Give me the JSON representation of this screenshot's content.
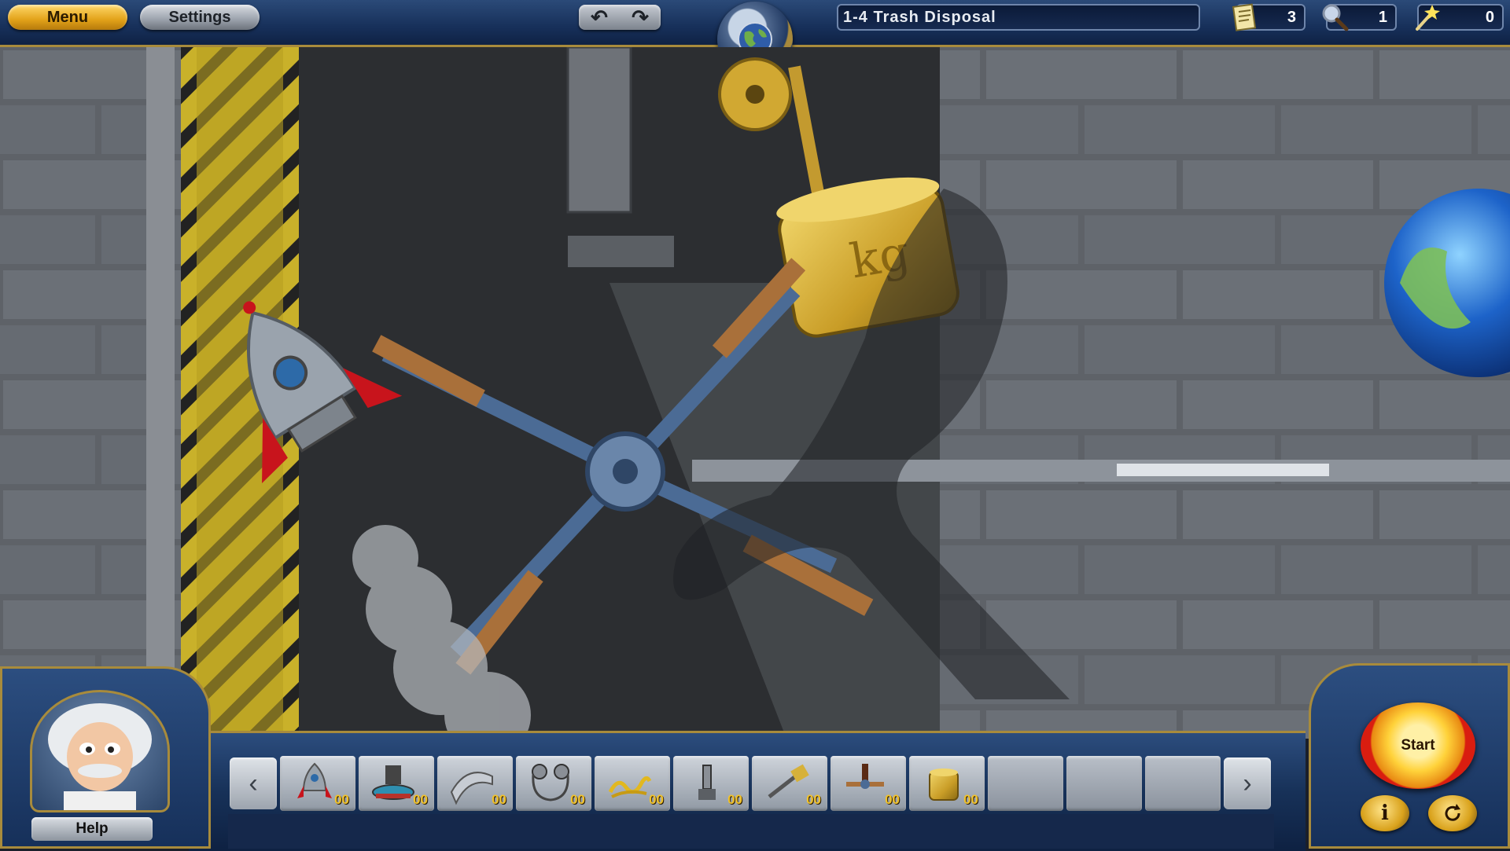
{
  "header": {
    "menu_label": "Menu",
    "settings_label": "Settings",
    "undo_icon": "undo-icon",
    "redo_icon": "redo-icon",
    "level_title": "1-4  Trash  Disposal",
    "counters": [
      {
        "name": "notes",
        "icon": "notepad-icon",
        "value": "3"
      },
      {
        "name": "magnifier",
        "icon": "magnifier-icon",
        "value": "1"
      },
      {
        "name": "wand",
        "icon": "magic-wand-icon",
        "value": "0"
      }
    ]
  },
  "scene": {
    "weight_label": "kg",
    "colors": {
      "wall": "#5d6166",
      "hazard_yellow": "#c9b12a",
      "weight_gold": "#d6b13a",
      "rocket_red": "#c8141c",
      "fan_blue": "#4b6b95"
    }
  },
  "tray": {
    "slots": [
      {
        "icon": "rocket-icon",
        "count": "00"
      },
      {
        "icon": "trampoline-icon",
        "count": "00"
      },
      {
        "icon": "ramp-icon",
        "count": "00"
      },
      {
        "icon": "pulley-belt-icon",
        "count": "00"
      },
      {
        "icon": "spring-icon",
        "count": "00"
      },
      {
        "icon": "lever-switch-icon",
        "count": "00"
      },
      {
        "icon": "hammer-arm-icon",
        "count": "00"
      },
      {
        "icon": "propeller-icon",
        "count": "00"
      },
      {
        "icon": "kg-weight-icon",
        "count": "00"
      },
      {
        "icon": "empty",
        "count": ""
      },
      {
        "icon": "empty",
        "count": ""
      },
      {
        "icon": "empty",
        "count": ""
      }
    ]
  },
  "footer": {
    "help_label": "Help",
    "start_label": "Start",
    "info_label": "i"
  }
}
